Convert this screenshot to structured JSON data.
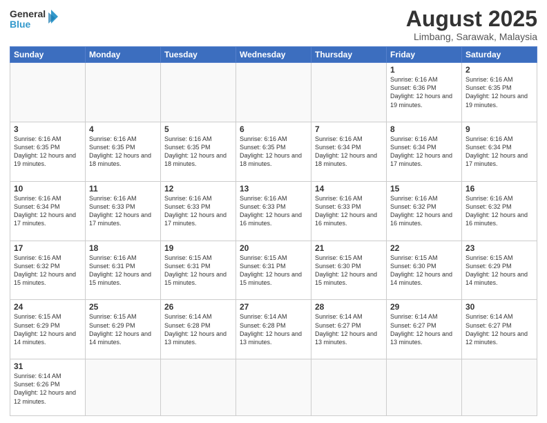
{
  "header": {
    "logo_general": "General",
    "logo_blue": "Blue",
    "month_year": "August 2025",
    "location": "Limbang, Sarawak, Malaysia"
  },
  "days_of_week": [
    "Sunday",
    "Monday",
    "Tuesday",
    "Wednesday",
    "Thursday",
    "Friday",
    "Saturday"
  ],
  "weeks": [
    [
      {
        "day": "",
        "info": ""
      },
      {
        "day": "",
        "info": ""
      },
      {
        "day": "",
        "info": ""
      },
      {
        "day": "",
        "info": ""
      },
      {
        "day": "",
        "info": ""
      },
      {
        "day": "1",
        "info": "Sunrise: 6:16 AM\nSunset: 6:36 PM\nDaylight: 12 hours and 19 minutes."
      },
      {
        "day": "2",
        "info": "Sunrise: 6:16 AM\nSunset: 6:35 PM\nDaylight: 12 hours and 19 minutes."
      }
    ],
    [
      {
        "day": "3",
        "info": "Sunrise: 6:16 AM\nSunset: 6:35 PM\nDaylight: 12 hours and 19 minutes."
      },
      {
        "day": "4",
        "info": "Sunrise: 6:16 AM\nSunset: 6:35 PM\nDaylight: 12 hours and 18 minutes."
      },
      {
        "day": "5",
        "info": "Sunrise: 6:16 AM\nSunset: 6:35 PM\nDaylight: 12 hours and 18 minutes."
      },
      {
        "day": "6",
        "info": "Sunrise: 6:16 AM\nSunset: 6:35 PM\nDaylight: 12 hours and 18 minutes."
      },
      {
        "day": "7",
        "info": "Sunrise: 6:16 AM\nSunset: 6:34 PM\nDaylight: 12 hours and 18 minutes."
      },
      {
        "day": "8",
        "info": "Sunrise: 6:16 AM\nSunset: 6:34 PM\nDaylight: 12 hours and 17 minutes."
      },
      {
        "day": "9",
        "info": "Sunrise: 6:16 AM\nSunset: 6:34 PM\nDaylight: 12 hours and 17 minutes."
      }
    ],
    [
      {
        "day": "10",
        "info": "Sunrise: 6:16 AM\nSunset: 6:34 PM\nDaylight: 12 hours and 17 minutes."
      },
      {
        "day": "11",
        "info": "Sunrise: 6:16 AM\nSunset: 6:33 PM\nDaylight: 12 hours and 17 minutes."
      },
      {
        "day": "12",
        "info": "Sunrise: 6:16 AM\nSunset: 6:33 PM\nDaylight: 12 hours and 17 minutes."
      },
      {
        "day": "13",
        "info": "Sunrise: 6:16 AM\nSunset: 6:33 PM\nDaylight: 12 hours and 16 minutes."
      },
      {
        "day": "14",
        "info": "Sunrise: 6:16 AM\nSunset: 6:33 PM\nDaylight: 12 hours and 16 minutes."
      },
      {
        "day": "15",
        "info": "Sunrise: 6:16 AM\nSunset: 6:32 PM\nDaylight: 12 hours and 16 minutes."
      },
      {
        "day": "16",
        "info": "Sunrise: 6:16 AM\nSunset: 6:32 PM\nDaylight: 12 hours and 16 minutes."
      }
    ],
    [
      {
        "day": "17",
        "info": "Sunrise: 6:16 AM\nSunset: 6:32 PM\nDaylight: 12 hours and 15 minutes."
      },
      {
        "day": "18",
        "info": "Sunrise: 6:16 AM\nSunset: 6:31 PM\nDaylight: 12 hours and 15 minutes."
      },
      {
        "day": "19",
        "info": "Sunrise: 6:15 AM\nSunset: 6:31 PM\nDaylight: 12 hours and 15 minutes."
      },
      {
        "day": "20",
        "info": "Sunrise: 6:15 AM\nSunset: 6:31 PM\nDaylight: 12 hours and 15 minutes."
      },
      {
        "day": "21",
        "info": "Sunrise: 6:15 AM\nSunset: 6:30 PM\nDaylight: 12 hours and 15 minutes."
      },
      {
        "day": "22",
        "info": "Sunrise: 6:15 AM\nSunset: 6:30 PM\nDaylight: 12 hours and 14 minutes."
      },
      {
        "day": "23",
        "info": "Sunrise: 6:15 AM\nSunset: 6:29 PM\nDaylight: 12 hours and 14 minutes."
      }
    ],
    [
      {
        "day": "24",
        "info": "Sunrise: 6:15 AM\nSunset: 6:29 PM\nDaylight: 12 hours and 14 minutes."
      },
      {
        "day": "25",
        "info": "Sunrise: 6:15 AM\nSunset: 6:29 PM\nDaylight: 12 hours and 14 minutes."
      },
      {
        "day": "26",
        "info": "Sunrise: 6:14 AM\nSunset: 6:28 PM\nDaylight: 12 hours and 13 minutes."
      },
      {
        "day": "27",
        "info": "Sunrise: 6:14 AM\nSunset: 6:28 PM\nDaylight: 12 hours and 13 minutes."
      },
      {
        "day": "28",
        "info": "Sunrise: 6:14 AM\nSunset: 6:27 PM\nDaylight: 12 hours and 13 minutes."
      },
      {
        "day": "29",
        "info": "Sunrise: 6:14 AM\nSunset: 6:27 PM\nDaylight: 12 hours and 13 minutes."
      },
      {
        "day": "30",
        "info": "Sunrise: 6:14 AM\nSunset: 6:27 PM\nDaylight: 12 hours and 12 minutes."
      }
    ],
    [
      {
        "day": "31",
        "info": "Sunrise: 6:14 AM\nSunset: 6:26 PM\nDaylight: 12 hours and 12 minutes."
      },
      {
        "day": "",
        "info": ""
      },
      {
        "day": "",
        "info": ""
      },
      {
        "day": "",
        "info": ""
      },
      {
        "day": "",
        "info": ""
      },
      {
        "day": "",
        "info": ""
      },
      {
        "day": "",
        "info": ""
      }
    ]
  ]
}
